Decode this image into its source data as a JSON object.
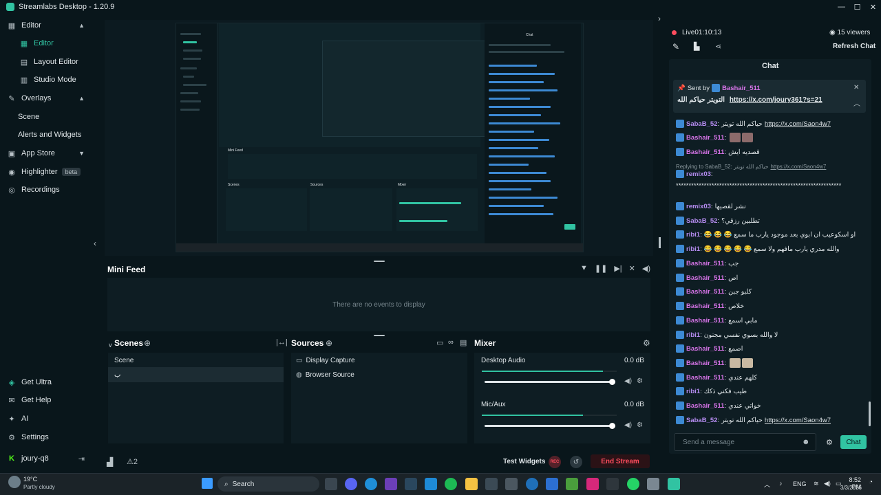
{
  "window": {
    "title": "Streamlabs Desktop - 1.20.9",
    "controls": [
      "—",
      "☐",
      "✕"
    ]
  },
  "sidebar": {
    "items": [
      {
        "label": "Editor",
        "icon": "editor-icon",
        "expanded": true
      },
      {
        "label": "Editor",
        "icon": "editor-sub-icon",
        "active": true
      },
      {
        "label": "Layout Editor",
        "icon": "layout-icon"
      },
      {
        "label": "Studio Mode",
        "icon": "studio-icon"
      },
      {
        "label": "Overlays",
        "icon": "overlays-icon",
        "expanded": true
      },
      {
        "label": "Scene"
      },
      {
        "label": "Alerts and Widgets"
      },
      {
        "label": "App Store",
        "icon": "store-icon"
      },
      {
        "label": "Highlighter",
        "icon": "highlighter-icon",
        "badge": "beta"
      },
      {
        "label": "Recordings",
        "icon": "recordings-icon"
      }
    ],
    "bottom": [
      {
        "label": "Get Ultra",
        "icon": "ultra-icon"
      },
      {
        "label": "Get Help",
        "icon": "help-icon"
      },
      {
        "label": "AI",
        "icon": "ai-icon"
      },
      {
        "label": "Settings",
        "icon": "settings-icon"
      },
      {
        "label": "joury-q8",
        "icon": "kick-icon"
      }
    ]
  },
  "minifeed": {
    "title": "Mini Feed",
    "empty": "There are no events to display"
  },
  "scenes": {
    "title": "Scenes",
    "header": "Scene",
    "items": [
      "ب"
    ]
  },
  "sources": {
    "title": "Sources",
    "items": [
      "Display Capture",
      "Browser Source"
    ]
  },
  "mixer": {
    "title": "Mixer",
    "channels": [
      {
        "name": "Desktop Audio",
        "db": "0.0 dB",
        "volume": 1.0,
        "meter": 0.9
      },
      {
        "name": "Mic/Aux",
        "db": "0.0 dB",
        "volume": 1.0,
        "meter": 0.75
      }
    ]
  },
  "footer": {
    "test_widgets": "Test Widgets",
    "rec": "REC",
    "end_stream": "End Stream",
    "notif_count": "2"
  },
  "stream": {
    "live_label": "Live",
    "time": "01:10:13",
    "viewers": "15 viewers",
    "refresh": "Refresh Chat"
  },
  "chat": {
    "title": "Chat",
    "pinned": {
      "prefix": "Sent by",
      "user": "Bashair_511",
      "text": "التويتر حياكم الله",
      "link": "https://x.com/joury361?s=21"
    },
    "messages": [
      {
        "user": "SabaB_52",
        "color": "#b58cf0",
        "text": "حياكم الله تويتر",
        "link": "https://x.com/Saon4w7"
      },
      {
        "user": "Bashair_511",
        "color": "#d774e8",
        "text": "",
        "emotes": 2
      },
      {
        "user": "Bashair_511",
        "color": "#d774e8",
        "text": "قصديه ايش"
      },
      {
        "reply": "Replying to SabaB_52: حياكم الله تويتر",
        "link": "https://x.com/Saon4w7"
      },
      {
        "user": "remix03",
        "color": "#b58cf0",
        "text": ""
      },
      {
        "text": "*****************************************************************"
      },
      {
        "user": "remix03",
        "color": "#b58cf0",
        "text": "نشر لقصيها"
      },
      {
        "user": "SabaB_52",
        "color": "#b58cf0",
        "text": "تطلبين رزقي؟"
      },
      {
        "user": "ribi1",
        "color": "#b58cf0",
        "text": "😂 😂 😂 او اسكوعيب ان ابوي بعد موجود يارب ما سمع"
      },
      {
        "user": "ribi1",
        "color": "#b58cf0",
        "text": "😂 😂 😂 😂 😂 والله مدري يارب مافهم ولا سمع"
      },
      {
        "user": "Bashair_511",
        "color": "#d774e8",
        "text": "جب"
      },
      {
        "user": "Bashair_511",
        "color": "#d774e8",
        "text": "اص"
      },
      {
        "user": "Bashair_511",
        "color": "#d774e8",
        "text": "كلبو جبن"
      },
      {
        "user": "Bashair_511",
        "color": "#d774e8",
        "text": "خلاص"
      },
      {
        "user": "Bashair_511",
        "color": "#d774e8",
        "text": "مابي اسمع"
      },
      {
        "user": "ribi1",
        "color": "#b58cf0",
        "text": "لا والله بسوي نفسي مجنون"
      },
      {
        "user": "Bashair_511",
        "color": "#d774e8",
        "text": "اصمع"
      },
      {
        "user": "Bashair_511",
        "color": "#d774e8",
        "text": "",
        "emotes": 2,
        "cat": true
      },
      {
        "user": "Bashair_511",
        "color": "#d774e8",
        "text": "كلهم عندي"
      },
      {
        "user": "ribi1",
        "color": "#b58cf0",
        "text": "طيب فكني ذكك"
      },
      {
        "user": "Bashair_511",
        "color": "#d774e8",
        "text": "خواتي عندي"
      },
      {
        "user": "SabaB_52",
        "color": "#b58cf0",
        "text": "حياكم الله تويتر",
        "link": "https://x.com/Saon4w7"
      }
    ],
    "input_placeholder": "Send a message",
    "send_label": "Chat"
  },
  "taskbar": {
    "weather_temp": "19°C",
    "weather_desc": "Partly cloudy",
    "search": "Search",
    "lang": "ENG",
    "time": "8:52 PM",
    "date": "3/3/2026"
  },
  "preview_labels": {
    "mini_feed": "Mini Feed",
    "scenes": "Scenes",
    "sources": "Sources",
    "mixer": "Mixer",
    "chat": "Chat"
  }
}
